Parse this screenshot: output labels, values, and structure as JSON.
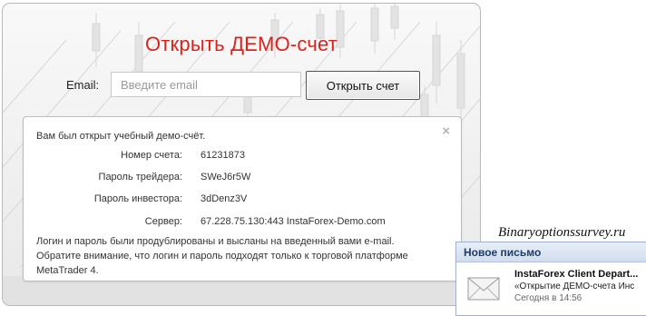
{
  "form": {
    "title": "Открыть ДЕМО-счет",
    "email_label": "Email:",
    "email_placeholder": "Введите email",
    "email_value": "",
    "submit_label": "Открыть счет"
  },
  "info": {
    "close_glyph": "×",
    "intro": "Вам был открыт учебный демо-счёт.",
    "rows": [
      {
        "label": "Номер счета:",
        "value": "61231873"
      },
      {
        "label": "Пароль трейдера:",
        "value": "SWeJ6r5W"
      },
      {
        "label": "Пароль инвестора:",
        "value": "3dDenz3V"
      },
      {
        "label": "Сервер:",
        "value": "67.228.75.130:443 InstaForex-Demo.com"
      }
    ],
    "note_line1": "Логин и пароль были продублированы и высланы на введенный вами e-mail.",
    "note_line2": "Обратите внимание, что логин и пароль подходят только к торговой платформе",
    "note_line3": "MetaTrader 4."
  },
  "watermark": "Binaryoptionssurvey.ru",
  "notification": {
    "header": "Новое письмо",
    "icon": "envelope-icon",
    "sender": "InstaForex Client Depart...",
    "subject": "«Открытие ДЕМО-счета Инс",
    "time": "Сегодня в 14:56"
  },
  "colors": {
    "title": "#d9231c",
    "notification_header": "#1f3b68"
  }
}
